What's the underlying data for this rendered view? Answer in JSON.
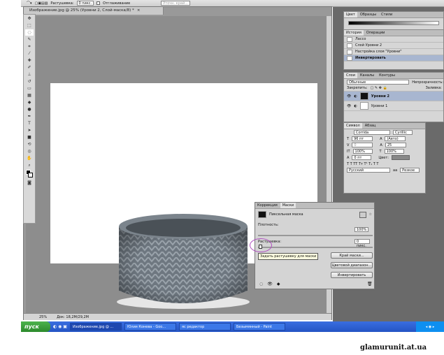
{
  "option_bar": {
    "feather_label": "Растушевка:",
    "feather_value": "0 пикс.",
    "antialias_label": "Отглаживание",
    "refine_label": "Уточн. край..."
  },
  "document": {
    "tab_title": "Изображение.jpg @ 25% (Уровни 2, Слой-маска/8) *",
    "close": "×",
    "zoom": "25%",
    "doc_info": "Док: 18,2М/29,2М"
  },
  "color_panel": {
    "tabs": [
      "Цвет",
      "Образцы",
      "Стили"
    ]
  },
  "history_panel": {
    "tabs": [
      "История",
      "Операции"
    ],
    "items": [
      "Лассо",
      "Слой Уровни 2",
      "Настройка слоя \"Уровни\"",
      "Инвертировать"
    ]
  },
  "layers_panel": {
    "tabs": [
      "Слои",
      "Каналы",
      "Контуры"
    ],
    "blend_mode": "Обычные",
    "opacity_label": "Непрозрачность:",
    "lock_label": "Закрепить:",
    "fill_label": "Заливка:",
    "layers": [
      {
        "name": "Уровни 2",
        "selected": true
      },
      {
        "name": "Уровни 1",
        "selected": false
      }
    ]
  },
  "character_panel": {
    "tabs": [
      "Символ",
      "Абзац"
    ],
    "font": "Corrida",
    "script": "Cyrillic",
    "size": "96 пт",
    "leading": "(Авто)",
    "kerning": "0",
    "tracking": "25",
    "vscale": "100%",
    "hscale": "100%",
    "baseline": "0 пт",
    "color_label": "Цвет:",
    "language": "Русский",
    "aa_mode": "Резкое",
    "aa_icon": "aa"
  },
  "mask_panel": {
    "tabs": [
      "Коррекция",
      "Маски"
    ],
    "title": "Пиксельная маска",
    "density_label": "Плотность:",
    "density_value": "100%",
    "feather_label": "Растушевка:",
    "feather_value": "0 пикс.",
    "tooltip": "Задать растушевку для маски",
    "buttons": [
      "Край маски...",
      "Цветовой диапазон...",
      "Инвертировать"
    ]
  },
  "taskbar": {
    "start": "пуск",
    "tasks": [
      "Изображение.jpg @ ...",
      "Юлия Конева - Goo...",
      "яс редактор",
      "Безымянный - Paint"
    ]
  },
  "watermark": "glamurunit.at.ua"
}
